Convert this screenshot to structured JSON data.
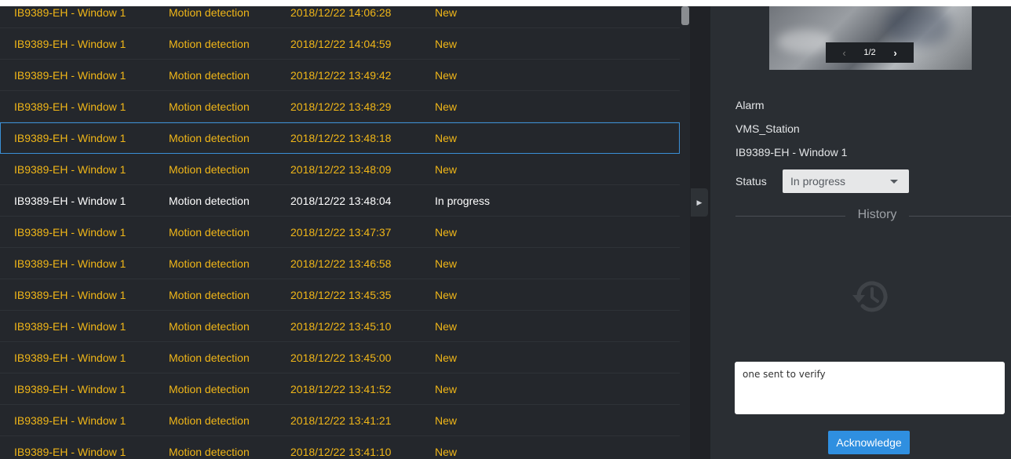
{
  "events": [
    {
      "source": "IB9389-EH - Window 1",
      "type": "Motion detection",
      "time": "2018/12/22 14:06:28",
      "status": "New"
    },
    {
      "source": "IB9389-EH - Window 1",
      "type": "Motion detection",
      "time": "2018/12/22 14:04:59",
      "status": "New"
    },
    {
      "source": "IB9389-EH - Window 1",
      "type": "Motion detection",
      "time": "2018/12/22 13:49:42",
      "status": "New"
    },
    {
      "source": "IB9389-EH - Window 1",
      "type": "Motion detection",
      "time": "2018/12/22 13:48:29",
      "status": "New"
    },
    {
      "source": "IB9389-EH - Window 1",
      "type": "Motion detection",
      "time": "2018/12/22 13:48:18",
      "status": "New"
    },
    {
      "source": "IB9389-EH - Window 1",
      "type": "Motion detection",
      "time": "2018/12/22 13:48:09",
      "status": "New"
    },
    {
      "source": "IB9389-EH - Window 1",
      "type": "Motion detection",
      "time": "2018/12/22 13:48:04",
      "status": "In progress"
    },
    {
      "source": "IB9389-EH - Window 1",
      "type": "Motion detection",
      "time": "2018/12/22 13:47:37",
      "status": "New"
    },
    {
      "source": "IB9389-EH - Window 1",
      "type": "Motion detection",
      "time": "2018/12/22 13:46:58",
      "status": "New"
    },
    {
      "source": "IB9389-EH - Window 1",
      "type": "Motion detection",
      "time": "2018/12/22 13:45:35",
      "status": "New"
    },
    {
      "source": "IB9389-EH - Window 1",
      "type": "Motion detection",
      "time": "2018/12/22 13:45:10",
      "status": "New"
    },
    {
      "source": "IB9389-EH - Window 1",
      "type": "Motion detection",
      "time": "2018/12/22 13:45:00",
      "status": "New"
    },
    {
      "source": "IB9389-EH - Window 1",
      "type": "Motion detection",
      "time": "2018/12/22 13:41:52",
      "status": "New"
    },
    {
      "source": "IB9389-EH - Window 1",
      "type": "Motion detection",
      "time": "2018/12/22 13:41:21",
      "status": "New"
    },
    {
      "source": "IB9389-EH - Window 1",
      "type": "Motion detection",
      "time": "2018/12/22 13:41:10",
      "status": "New"
    }
  ],
  "colors": {
    "new_status": "#f0b618",
    "in_progress_status": "#ffffff",
    "selection_border": "#3a8fd6",
    "accent_button": "#2f8fe0"
  },
  "detail": {
    "snapshot_page": "1/2",
    "alarm_type": "Alarm",
    "station": "VMS_Station",
    "source": "IB9389-EH - Window 1",
    "status_label": "Status",
    "status_value": "In progress",
    "history_title": "History",
    "note_text": "one sent to verify",
    "acknowledge_label": "Acknowledge"
  },
  "icons": {
    "snapshot_prev": "chevron-left-icon",
    "snapshot_next": "chevron-right-icon",
    "collapse": "caret-right-icon",
    "history": "history-icon",
    "dropdown": "caret-down-icon"
  }
}
